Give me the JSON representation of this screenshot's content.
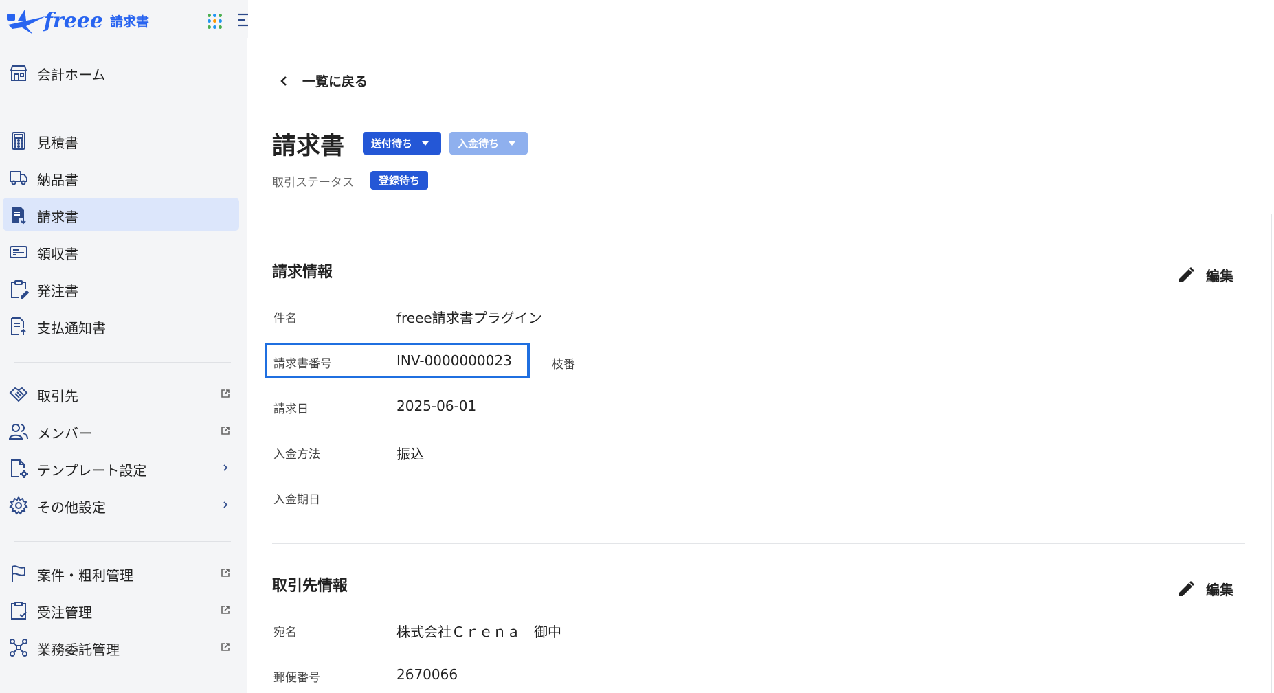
{
  "app": {
    "logo_text": "freee",
    "logo_sub": "請求書"
  },
  "colors": {
    "accent": "#2457d6",
    "accent_light": "#8fb0ee",
    "highlight": "#1f6fe0",
    "active_bg": "#dce6fb"
  },
  "sidebar": {
    "items": [
      {
        "label": "会計ホーム",
        "icon": "store-icon"
      },
      {
        "label": "見積書",
        "icon": "calculator-icon"
      },
      {
        "label": "納品書",
        "icon": "truck-icon"
      },
      {
        "label": "請求書",
        "icon": "invoice-icon",
        "active": true
      },
      {
        "label": "領収書",
        "icon": "receipt-icon"
      },
      {
        "label": "発注書",
        "icon": "clipboard-edit-icon"
      },
      {
        "label": "支払通知書",
        "icon": "document-upload-icon"
      },
      {
        "label": "取引先",
        "icon": "handshake-icon",
        "trail": "external-link-icon"
      },
      {
        "label": "メンバー",
        "icon": "users-icon",
        "trail": "external-link-icon"
      },
      {
        "label": "テンプレート設定",
        "icon": "template-settings-icon",
        "trail": "chevron-right-icon"
      },
      {
        "label": "その他設定",
        "icon": "gear-icon",
        "trail": "chevron-right-icon"
      },
      {
        "label": "案件・粗利管理",
        "icon": "flag-icon",
        "trail": "external-link-icon"
      },
      {
        "label": "受注管理",
        "icon": "clipboard-check-icon",
        "trail": "external-link-icon"
      },
      {
        "label": "業務委託管理",
        "icon": "network-icon",
        "trail": "external-link-icon"
      }
    ]
  },
  "header": {
    "back_label": "一覧に戻る",
    "title": "請求書",
    "send_status": "送付待ち",
    "payment_status": "入金待ち",
    "deal_status_label": "取引ステータス",
    "deal_status": "登録待ち"
  },
  "billing": {
    "title": "請求情報",
    "edit_label": "編集",
    "fields": [
      {
        "label": "件名",
        "value": "freee請求書プラグイン"
      },
      {
        "label": "請求書番号",
        "value": "INV-0000000023"
      },
      {
        "label": "請求日",
        "value": "2025-06-01"
      },
      {
        "label": "入金方法",
        "value": "振込"
      },
      {
        "label": "入金期日",
        "value": ""
      }
    ],
    "branch_label": "枝番"
  },
  "partner": {
    "title": "取引先情報",
    "edit_label": "編集",
    "fields": [
      {
        "label": "宛名",
        "value": "株式会社Ｃｒｅｎａ　御中"
      },
      {
        "label": "郵便番号",
        "value": "2670066"
      }
    ]
  }
}
